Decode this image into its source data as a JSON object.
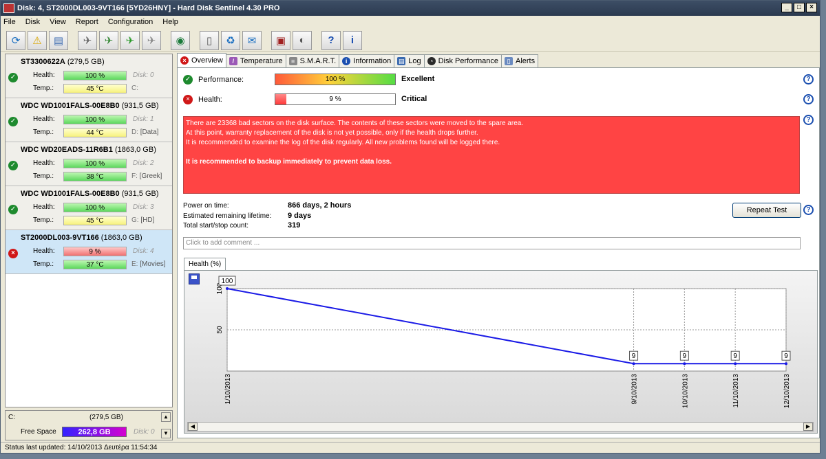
{
  "window": {
    "title": "Disk: 4, ST2000DL003-9VT166 [5YD26HNY]  -  Hard Disk Sentinel 4.30 PRO",
    "buttons": [
      "_",
      "□",
      "×"
    ]
  },
  "menu": [
    "File",
    "Disk",
    "View",
    "Report",
    "Configuration",
    "Help"
  ],
  "toolbar": {
    "icons": [
      "refresh-icon",
      "warning-icon",
      "disk-icon",
      "satellite-icon",
      "satellite-green-icon",
      "satellite-check-icon",
      "satellite-gray-icon",
      "globe-icon",
      "document-icon",
      "recycle-icon",
      "mail-icon",
      "monitor-icon",
      "speaker-icon",
      "help-icon",
      "info-icon"
    ]
  },
  "disks": [
    {
      "name": "ST3300622A",
      "size": "(279,5 GB)",
      "health_label": "Health:",
      "health": "100 %",
      "temp_label": "Temp.:",
      "temp": "45 °C",
      "disk_no": "Disk: 0",
      "drive": "C:",
      "drive_label": "",
      "status": "ok",
      "temp_color": "yellow",
      "health_color": "green"
    },
    {
      "name": "WDC WD1001FALS-00E8B0",
      "size": "(931,5 GB)",
      "health_label": "Health:",
      "health": "100 %",
      "temp_label": "Temp.:",
      "temp": "44 °C",
      "disk_no": "Disk: 1",
      "drive": "D:",
      "drive_label": "[Data]",
      "status": "ok",
      "temp_color": "yellow",
      "health_color": "green"
    },
    {
      "name": "WDC WD20EADS-11R6B1",
      "size": "(1863,0 GB)",
      "health_label": "Health:",
      "health": "100 %",
      "temp_label": "Temp.:",
      "temp": "38 °C",
      "disk_no": "Disk: 2",
      "drive": "F:",
      "drive_label": "[Greek]",
      "status": "ok",
      "temp_color": "green",
      "health_color": "green"
    },
    {
      "name": "WDC WD1001FALS-00E8B0",
      "size": "(931,5 GB)",
      "health_label": "Health:",
      "health": "100 %",
      "temp_label": "Temp.:",
      "temp": "45 °C",
      "disk_no": "Disk: 3",
      "drive": "G:",
      "drive_label": "[HD]",
      "status": "ok",
      "temp_color": "yellow",
      "health_color": "green"
    },
    {
      "name": "ST2000DL003-9VT166",
      "size": "(1863,0 GB)",
      "health_label": "Health:",
      "health": "9 %",
      "temp_label": "Temp.:",
      "temp": "37 °C",
      "disk_no": "Disk: 4",
      "drive": "E:",
      "drive_label": "[Movies]",
      "status": "bad",
      "temp_color": "green",
      "health_color": "red",
      "selected": true
    }
  ],
  "free_space": {
    "drive": "C:",
    "size": "(279,5 GB)",
    "label": "Free Space",
    "value": "262,8 GB",
    "disk_no": "Disk: 0"
  },
  "status_bar": "Status last updated: 14/10/2013 Δευτέρα 11:54:34",
  "tabs": [
    {
      "label": "Overview",
      "icon": "error-icon",
      "active": true
    },
    {
      "label": "Temperature",
      "icon": "thermometer-icon"
    },
    {
      "label": "S.M.A.R.T.",
      "icon": "smart-icon"
    },
    {
      "label": "Information",
      "icon": "info-icon"
    },
    {
      "label": "Log",
      "icon": "log-icon"
    },
    {
      "label": "Disk Performance",
      "icon": "gauge-icon"
    },
    {
      "label": "Alerts",
      "icon": "alerts-icon"
    }
  ],
  "overview": {
    "performance": {
      "label": "Performance:",
      "value": "100 %",
      "fraction": 1.0,
      "rating": "Excellent"
    },
    "health": {
      "label": "Health:",
      "value": "9 %",
      "fraction": 0.09,
      "rating": "Critical"
    },
    "message": {
      "line1": "There are 23368 bad sectors on the disk surface. The contents of these sectors were moved to the spare area.",
      "line2": "At this point, warranty replacement of the disk is not yet possible, only if the health drops further.",
      "line3": "It is recommended to examine the log of the disk regularly. All new problems found will be logged there.",
      "line4": "It is recommended to backup immediately to prevent data loss."
    },
    "power_on_label": "Power on time:",
    "power_on": "866 days, 2 hours",
    "remaining_label": "Estimated remaining lifetime:",
    "remaining": "9 days",
    "startstop_label": "Total start/stop count:",
    "startstop": "319",
    "repeat_button": "Repeat Test",
    "comment_placeholder": "Click to add comment ...",
    "graph_tab": "Health (%)"
  },
  "chart_data": {
    "type": "line",
    "title": "",
    "xlabel": "",
    "ylabel": "",
    "x": [
      "1/10/2013",
      "9/10/2013",
      "10/10/2013",
      "11/10/2013",
      "12/10/2013"
    ],
    "x_days": [
      1,
      9,
      10,
      11,
      12
    ],
    "values": [
      100,
      9,
      9,
      9,
      9
    ],
    "data_labels": [
      "100",
      "9",
      "9",
      "9",
      "9"
    ],
    "yticks": [
      "100",
      "50"
    ],
    "ylim": [
      0,
      100
    ],
    "xlim_days": [
      1,
      12
    ],
    "color": "#1a1ae6",
    "grid": true
  }
}
